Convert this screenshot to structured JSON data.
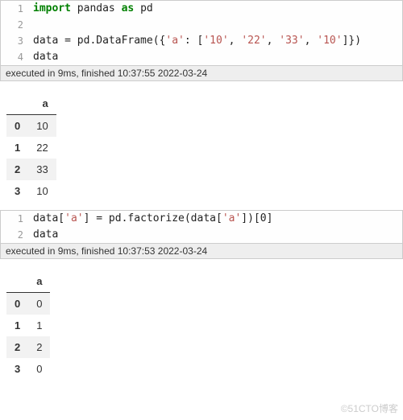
{
  "cell1": {
    "lines": [
      {
        "n": "1",
        "html": "<span class='kw-import'>import</span> <span class='plain'>pandas</span> <span class='kw-as'>as</span> <span class='plain'>pd</span>"
      },
      {
        "n": "2",
        "html": ""
      },
      {
        "n": "3",
        "html": "<span class='plain'>data = pd.DataFrame({</span><span class='str'>'a'</span><span class='plain'>: [</span><span class='str'>'10'</span><span class='plain'>, </span><span class='str'>'22'</span><span class='plain'>, </span><span class='str'>'33'</span><span class='plain'>, </span><span class='str'>'10'</span><span class='plain'>]})</span>"
      },
      {
        "n": "4",
        "html": "<span class='plain'>data</span>"
      }
    ],
    "exec": "executed in 9ms, finished 10:37:55 2022-03-24"
  },
  "table1": {
    "columns": [
      "a"
    ],
    "index": [
      "0",
      "1",
      "2",
      "3"
    ],
    "rows": [
      [
        "10"
      ],
      [
        "22"
      ],
      [
        "33"
      ],
      [
        "10"
      ]
    ]
  },
  "cell2": {
    "lines": [
      {
        "n": "1",
        "html": "<span class='plain'>data[</span><span class='str'>'a'</span><span class='plain'>] = pd.factorize(data[</span><span class='str'>'a'</span><span class='plain'>])[0]</span>"
      },
      {
        "n": "2",
        "html": "<span class='plain'>data</span>"
      }
    ],
    "exec": "executed in 9ms, finished 10:37:53 2022-03-24"
  },
  "table2": {
    "columns": [
      "a"
    ],
    "index": [
      "0",
      "1",
      "2",
      "3"
    ],
    "rows": [
      [
        "0"
      ],
      [
        "1"
      ],
      [
        "2"
      ],
      [
        "0"
      ]
    ]
  },
  "watermark": "©51CTO博客",
  "chart_data": [
    {
      "type": "table",
      "title": "DataFrame output 1",
      "columns": [
        "a"
      ],
      "index": [
        0,
        1,
        2,
        3
      ],
      "data": {
        "a": [
          "10",
          "22",
          "33",
          "10"
        ]
      }
    },
    {
      "type": "table",
      "title": "DataFrame output 2 (after factorize)",
      "columns": [
        "a"
      ],
      "index": [
        0,
        1,
        2,
        3
      ],
      "data": {
        "a": [
          0,
          1,
          2,
          0
        ]
      }
    }
  ]
}
